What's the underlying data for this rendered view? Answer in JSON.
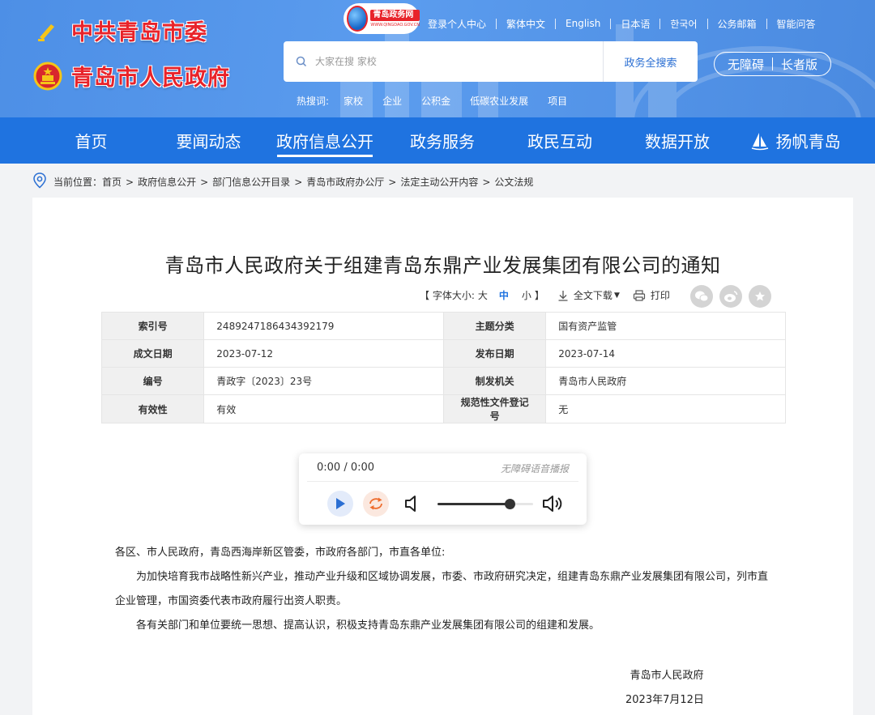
{
  "header": {
    "party_title": "中共青岛市委",
    "gov_title": "青岛市人民政府",
    "portal_name": "青岛政务网",
    "portal_url": "WWW.QINGDAO.GOV.CN",
    "top_links": [
      "登录个人中心",
      "繁体中文",
      "English",
      "日本语",
      "한국어",
      "公务邮箱",
      "智能问答"
    ],
    "search": {
      "placeholder": "大家在搜 家校",
      "button": "政务全搜索"
    },
    "hot_label": "热搜词:",
    "hot_words": [
      "家校",
      "企业",
      "公积金",
      "低碳农业发展",
      "项目"
    ],
    "access": {
      "barrier_free": "无障碍",
      "elder": "长者版"
    }
  },
  "nav": {
    "items": [
      "首页",
      "要闻动态",
      "政府信息公开",
      "政务服务",
      "政民互动",
      "数据开放",
      "扬帆青岛"
    ],
    "active_index": 2
  },
  "breadcrumb": {
    "prefix": "当前位置：",
    "items": [
      "首页",
      "政府信息公开",
      "部门信息公开目录",
      "青岛市政府办公厅",
      "法定主动公开内容",
      "公文法规"
    ],
    "sep": ">"
  },
  "article": {
    "title": "青岛市人民政府关于组建青岛东鼎产业发展集团有限公司的通知",
    "font_size": {
      "open": "【 字体大小:",
      "large": "大",
      "medium": "中",
      "small": "小",
      "close": "】"
    },
    "download": "全文下载",
    "print": "打印",
    "share_icons": [
      "wechat-icon",
      "weibo-icon",
      "favorite-icon"
    ],
    "meta": [
      {
        "k1": "索引号",
        "v1": "2489247186434392179",
        "k2": "主题分类",
        "v2": "国有资产监管"
      },
      {
        "k1": "成文日期",
        "v1": "2023-07-12",
        "k2": "发布日期",
        "v2": "2023-07-14"
      },
      {
        "k1": "编号",
        "v1": "青政字〔2023〕23号",
        "k2": "制发机关",
        "v2": "青岛市人民政府"
      },
      {
        "k1": "有效性",
        "v1": "有效",
        "k2": "规范性文件登记号",
        "v2": "无"
      }
    ],
    "player": {
      "time": "0:00 / 0:00",
      "label": "无障碍语音播报",
      "volume_level": 0.75
    },
    "paragraphs": [
      "各区、市人民政府，青岛西海岸新区管委，市政府各部门，市直各单位:",
      "为加快培育我市战略性新兴产业，推动产业升级和区域协调发展，市委、市政府研究决定，组建青岛东鼎产业发展集团有限公司，列市直企业管理，市国资委代表市政府履行出资人职责。",
      "各有关部门和单位要统一思想、提高认识，积极支持青岛东鼎产业发展集团有限公司的组建和发展。"
    ],
    "signature": {
      "org": "青岛市人民政府",
      "date": "2023年7月12日"
    }
  },
  "colors": {
    "header_bg": "#5b9cee",
    "nav_bg": "#1f73e0",
    "accent": "#1f73e0",
    "logo_red": "#e8232a"
  }
}
